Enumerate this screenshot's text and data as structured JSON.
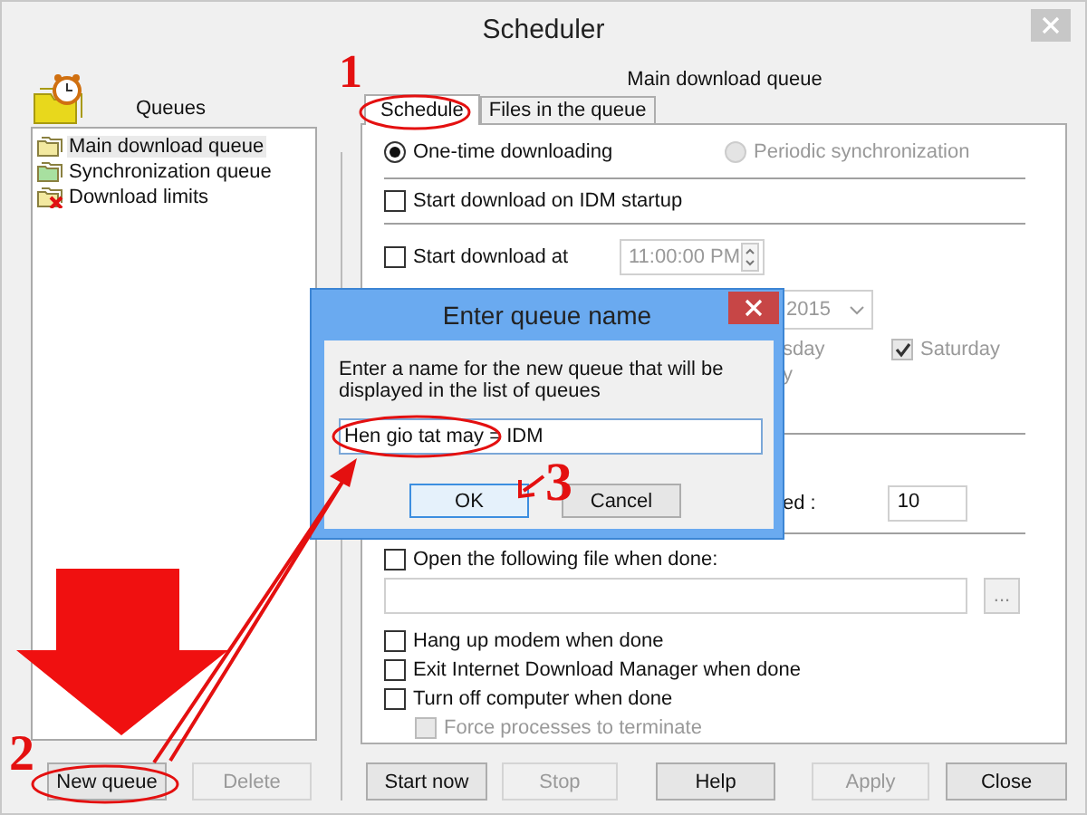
{
  "window": {
    "title": "Scheduler"
  },
  "queues": {
    "label": "Queues",
    "items": [
      {
        "label": "Main download queue",
        "selected": true,
        "kind": "main"
      },
      {
        "label": "Synchronization queue",
        "selected": false,
        "kind": "sync"
      },
      {
        "label": "Download limits",
        "selected": false,
        "kind": "limits"
      }
    ]
  },
  "queue_title": "Main download queue",
  "tabs": [
    {
      "label": "Schedule",
      "selected": true
    },
    {
      "label": "Files in the queue",
      "selected": false
    }
  ],
  "mode": [
    {
      "label": "One-time downloading",
      "selected": true,
      "disabled": false
    },
    {
      "label": "Periodic synchronization",
      "selected": false,
      "disabled": true
    }
  ],
  "start_on_startup": {
    "label": "Start download on IDM startup",
    "checked": false
  },
  "start_at": {
    "label": "Start download at",
    "checked": false,
    "time": "11:00:00 PM",
    "date": "2015"
  },
  "day_fragments": [
    "sday",
    "y"
  ],
  "saturday": {
    "label": "Saturday",
    "checked": true,
    "disabled": true
  },
  "retry": {
    "label": "ed :",
    "value": "10"
  },
  "open_file": {
    "label": "Open the following file when done:",
    "checked": false,
    "browse": "..."
  },
  "when_done": [
    {
      "label": "Hang up modem when done",
      "checked": false
    },
    {
      "label": "Exit Internet Download Manager when done",
      "checked": false
    },
    {
      "label": "Turn off computer when done",
      "checked": false
    }
  ],
  "force": {
    "label": "Force processes to terminate",
    "checked": false,
    "disabled": true
  },
  "left_buttons": [
    {
      "label": "New queue",
      "disabled": false
    },
    {
      "label": "Delete",
      "disabled": true
    }
  ],
  "buttons": [
    {
      "label": "Start now",
      "disabled": false
    },
    {
      "label": "Stop",
      "disabled": true
    },
    {
      "label": "Help",
      "disabled": false
    },
    {
      "label": "Apply",
      "disabled": true
    },
    {
      "label": "Close",
      "disabled": false
    }
  ],
  "dialog": {
    "title": "Enter queue name",
    "prompt": "Enter a name for the new queue that will be displayed in the list of queues",
    "value": "Hen gio tat may = IDM",
    "buttons": [
      {
        "label": "OK",
        "default": true
      },
      {
        "label": "Cancel",
        "default": false
      }
    ]
  },
  "annotations": [
    {
      "label": "1"
    },
    {
      "label": "2"
    },
    {
      "label": "3"
    }
  ]
}
